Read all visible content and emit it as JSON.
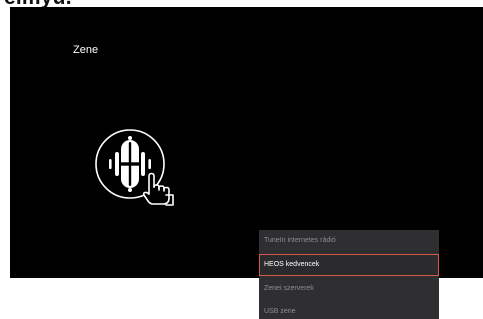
{
  "document": {
    "heading_fragment": "elmyu."
  },
  "screen": {
    "title": "Zene",
    "logo_icon": "heos-logo-icon",
    "pointer_icon": "pointing-hand-icon"
  },
  "menu": {
    "items": [
      {
        "label": "TuneIn internetes rádió",
        "selected": false
      },
      {
        "label": "HEOS kedvencek",
        "selected": true
      },
      {
        "label": "Zenei szerverek",
        "selected": false
      },
      {
        "label": "USB zene",
        "selected": false
      }
    ],
    "highlight_color": "#d5584c"
  }
}
